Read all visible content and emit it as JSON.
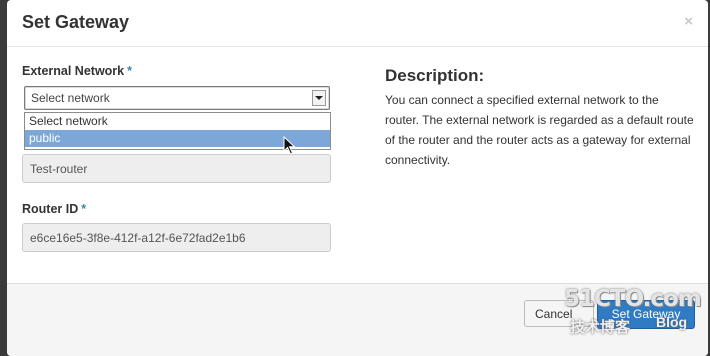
{
  "modal": {
    "title": "Set Gateway",
    "close_symbol": "×"
  },
  "form": {
    "external_network": {
      "label": "External Network",
      "required_marker": "*",
      "selected_value": "Select network",
      "options": [
        "Select network",
        "public"
      ],
      "highlighted_option": "public"
    },
    "router_name": {
      "value": "Test-router"
    },
    "router_id": {
      "label": "Router ID",
      "required_marker": "*",
      "value": "e6ce16e5-3f8e-412f-a12f-6e72fad2e1b6"
    }
  },
  "description": {
    "title": "Description:",
    "text": "You can connect a specified external network to the router. The external network is regarded as a default route of the router and the router acts as a gateway for external connectivity."
  },
  "footer": {
    "cancel_label": "Cancel",
    "submit_label": "Set Gateway"
  },
  "watermark": {
    "main": "51CTO.com",
    "sub": "技术博客",
    "blog": "Blog"
  },
  "colors": {
    "highlight": "#7da7d9",
    "required": "#3a87ad",
    "primary_button": "#2f7bc4"
  }
}
